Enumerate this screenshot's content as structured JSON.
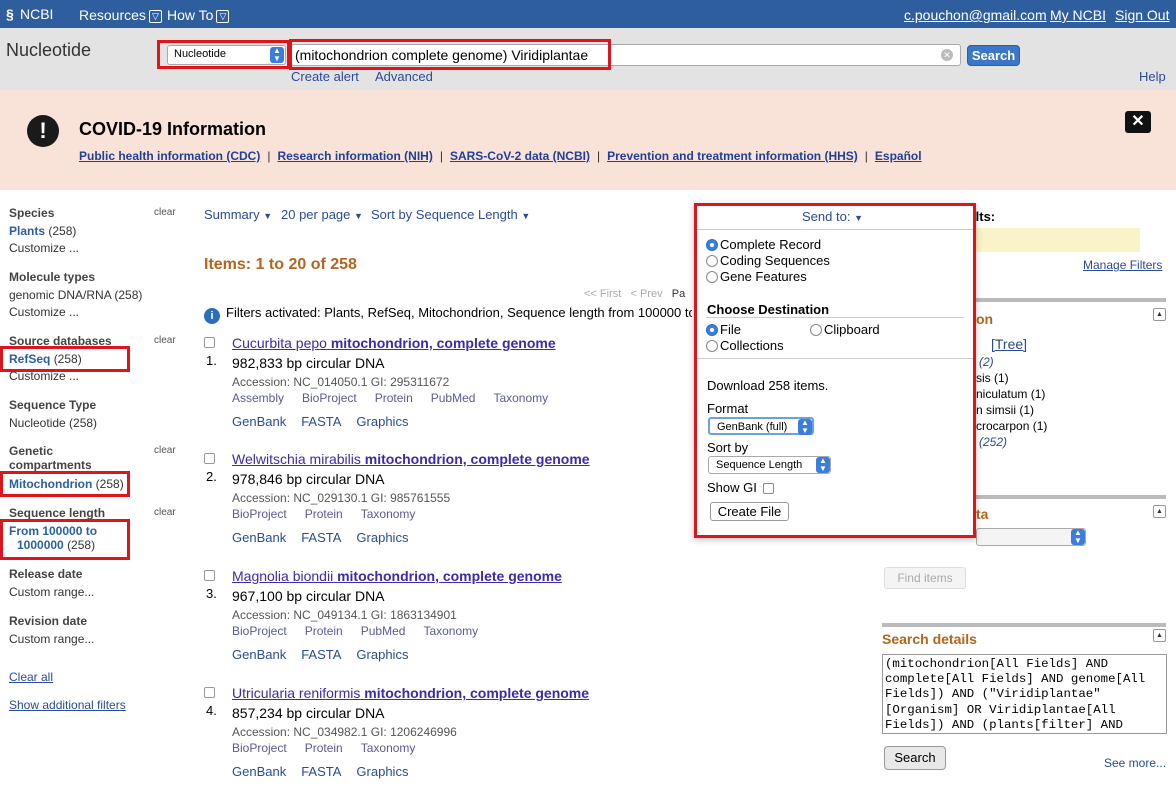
{
  "topbar": {
    "logo": "NCBI",
    "resources": "Resources",
    "howto": "How To",
    "user_email": "c.pouchon@gmail.com",
    "my_ncbi": "My NCBI",
    "sign_out": "Sign Out"
  },
  "search": {
    "db_title": "Nucleotide",
    "db_selected": "Nucleotide",
    "term": "(mitochondrion complete genome) Viridiplantae",
    "button": "Search",
    "create_alert": "Create alert",
    "advanced": "Advanced",
    "help": "Help"
  },
  "covid": {
    "title": "COVID-19 Information",
    "links": [
      "Public health information (CDC)",
      "Research information (NIH)",
      "SARS-CoV-2 data (NCBI)",
      "Prevention and treatment information (HHS)",
      "Español"
    ]
  },
  "left_filters": {
    "species_heading": "Species",
    "species_selected": "Plants",
    "species_count": "(258)",
    "species_customize": "Customize ...",
    "molecule_heading": "Molecule types",
    "molecule_item": "genomic DNA/RNA (258)",
    "molecule_customize": "Customize ...",
    "source_heading": "Source databases",
    "source_selected": "RefSeq",
    "source_count": "(258)",
    "source_customize": "Customize ...",
    "seqtype_heading": "Sequence Type",
    "seqtype_item": "Nucleotide (258)",
    "genetic_heading_1": "Genetic",
    "genetic_heading_2": "compartments",
    "genetic_selected": "Mitochondrion",
    "genetic_count": "(258)",
    "seqlen_heading": "Sequence length",
    "seqlen_selected_1": "From 100000 to",
    "seqlen_selected_2": "1000000",
    "seqlen_count": "(258)",
    "release_heading": "Release date",
    "release_item": "Custom range...",
    "revision_heading": "Revision date",
    "revision_item": "Custom range...",
    "clear_all": "Clear all",
    "show_additional": "Show additional filters",
    "clear": "clear"
  },
  "results": {
    "summary": "Summary",
    "per_page": "20 per page",
    "sort": "Sort by Sequence Length",
    "items_heading": "Items: 1 to 20 of 258",
    "pager_first": "<< First",
    "pager_prev": "< Prev",
    "pager_page": "Pa",
    "filters_activated": "Filters activated: Plants, RefSeq, Mitochondrion, Sequence length from 100000 to",
    "records": [
      {
        "num": "1.",
        "species": "Cucurbita pepo",
        "bold": "mitochondrion, complete genome",
        "desc": "982,833 bp circular DNA",
        "acc": "Accession: NC_014050.1   GI: 295311672",
        "links": [
          "Assembly",
          "BioProject",
          "Protein",
          "PubMed",
          "Taxonomy"
        ],
        "formats": [
          "GenBank",
          "FASTA",
          "Graphics"
        ]
      },
      {
        "num": "2.",
        "species": "Welwitschia mirabilis",
        "bold": "mitochondrion, complete genome",
        "desc": "978,846 bp circular DNA",
        "acc": "Accession: NC_029130.1   GI: 985761555",
        "links": [
          "BioProject",
          "Protein",
          "Taxonomy"
        ],
        "formats": [
          "GenBank",
          "FASTA",
          "Graphics"
        ]
      },
      {
        "num": "3.",
        "species": "Magnolia biondii",
        "bold": "mitochondrion, complete genome",
        "desc": "967,100 bp circular DNA",
        "acc": "Accession: NC_049134.1   GI: 1863134901",
        "links": [
          "BioProject",
          "Protein",
          "PubMed",
          "Taxonomy"
        ],
        "formats": [
          "GenBank",
          "FASTA",
          "Graphics"
        ]
      },
      {
        "num": "4.",
        "species": "Utricularia reniformis",
        "bold": "mitochondrion, complete genome",
        "desc": "857,234 bp circular DNA",
        "acc": "Accession: NC_034982.1   GI: 1206246996",
        "links": [
          "BioProject",
          "Protein",
          "Taxonomy"
        ],
        "formats": [
          "GenBank",
          "FASTA",
          "Graphics"
        ]
      }
    ]
  },
  "sendto": {
    "label": "Send to:",
    "options": [
      "Complete Record",
      "Coding Sequences",
      "Gene Features"
    ],
    "dest_heading": "Choose Destination",
    "dest_file": "File",
    "dest_clipboard": "Clipboard",
    "dest_collections": "Collections",
    "download": "Download 258 items.",
    "format_label": "Format",
    "format_value": "GenBank (full)",
    "sort_label": "Sort by",
    "sort_value": "Sequence Length",
    "show_gi": "Show GI",
    "create_file": "Create File"
  },
  "right": {
    "filter_title": "Filter your results:",
    "manage_filters": "Manage Filters",
    "tax_head_frag": "on",
    "tree": "[Tree]",
    "tax_lines": [
      "(2)",
      "sis (1)",
      "niculatum (1)",
      "n simsii (1)",
      "crocarpon (1)",
      "(252)"
    ],
    "box2_frag": "ta",
    "find_items": "Find items",
    "search_details_title": "Search details",
    "search_details": "(mitochondrion[All Fields] AND complete[All Fields] AND genome[All Fields]) AND (\"Viridiplantae\"[Organism] OR Viridiplantae[All Fields]) AND (plants[filter] AND",
    "search_btn": "Search",
    "see_more": "See more..."
  },
  "colors": {
    "topbar": "#2f5e9e",
    "highlight": "#e0141c",
    "covid_bg": "#f9e3d8",
    "items_heading": "#b5651d"
  }
}
